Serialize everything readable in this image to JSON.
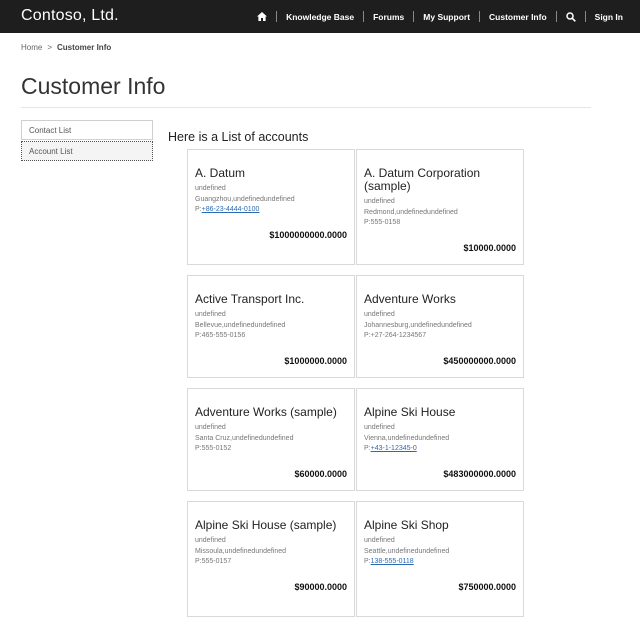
{
  "header": {
    "brand": "Contoso, Ltd.",
    "nav": [
      {
        "label": "Knowledge Base"
      },
      {
        "label": "Forums"
      },
      {
        "label": "My Support"
      },
      {
        "label": "Customer Info"
      },
      {
        "label": "Sign In"
      }
    ]
  },
  "breadcrumb": {
    "home": "Home",
    "sep": ">",
    "current": "Customer Info"
  },
  "page_title": "Customer Info",
  "sidebar": {
    "items": [
      {
        "label": "Contact List"
      },
      {
        "label": "Account List"
      }
    ]
  },
  "main": {
    "heading": "Here is a List of accounts",
    "accounts": [
      {
        "name": "A. Datum",
        "line1": "undefined",
        "location": "Guangzhou,undefinedundefined",
        "phone_prefix": "P:",
        "phone": "+86-23-4444-0100",
        "amount": "$1000000000.0000"
      },
      {
        "name": "A. Datum Corporation (sample)",
        "line1": "undefined",
        "location": "Redmond,undefinedundefined",
        "phone_prefix": "P:",
        "phone": "555-0158",
        "amount": "$10000.0000"
      },
      {
        "name": "Active Transport Inc.",
        "line1": "undefined",
        "location": "Bellevue,undefinedundefined",
        "phone_prefix": "P:",
        "phone": "465-555-0156",
        "amount": "$1000000.0000"
      },
      {
        "name": "Adventure Works",
        "line1": "undefined",
        "location": "Johannesburg,undefinedundefined",
        "phone_prefix": "P:",
        "phone": "+27-264-1234567",
        "amount": "$450000000.0000"
      },
      {
        "name": "Adventure Works (sample)",
        "line1": "undefined",
        "location": "Santa Cruz,undefinedundefined",
        "phone_prefix": "P:",
        "phone": "555-0152",
        "amount": "$60000.0000"
      },
      {
        "name": "Alpine Ski House",
        "line1": "undefined",
        "location": "Vienna,undefinedundefined",
        "phone_prefix": "P:",
        "phone": "+43-1-12345-0",
        "amount": "$483000000.0000"
      },
      {
        "name": "Alpine Ski House (sample)",
        "line1": "undefined",
        "location": "Missoula,undefinedundefined",
        "phone_prefix": "P:",
        "phone": "555-0157",
        "amount": "$90000.0000"
      },
      {
        "name": "Alpine Ski Shop",
        "line1": "undefined",
        "location": "Seattle,undefinedundefined",
        "phone_prefix": "P:",
        "phone": "138-555-0118",
        "amount": "$750000.0000"
      }
    ]
  },
  "colors": {
    "topbar": "#1e1e1e",
    "link": "#2a6ab4",
    "border": "#d9d9d9"
  }
}
